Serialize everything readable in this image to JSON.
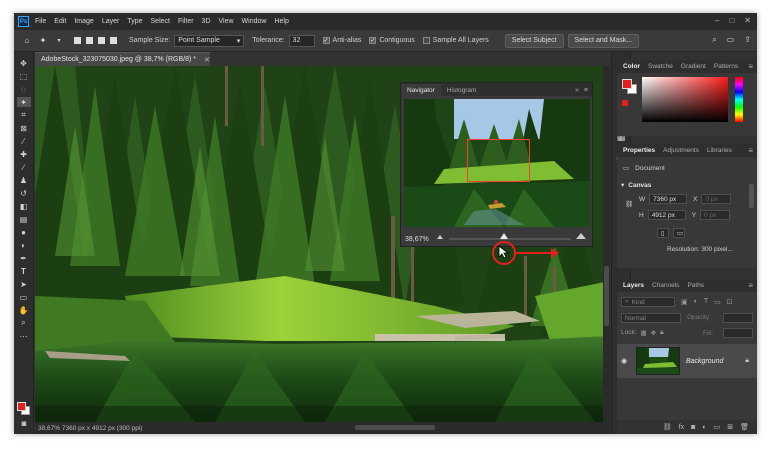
{
  "app": {
    "logo_text": "Ps",
    "menu": [
      "File",
      "Edit",
      "Image",
      "Layer",
      "Type",
      "Select",
      "Filter",
      "3D",
      "View",
      "Window",
      "Help"
    ],
    "window_controls": [
      "–",
      "□",
      "✕"
    ]
  },
  "options_bar": {
    "sample_size_label": "Sample Size:",
    "sample_size_value": "Point Sample",
    "tolerance_label": "Tolerance:",
    "tolerance_value": "32",
    "anti_alias_label": "Anti-alias",
    "anti_alias_checked": true,
    "contiguous_label": "Contiguous",
    "contiguous_checked": true,
    "sample_all_layers_label": "Sample All Layers",
    "sample_all_layers_checked": false,
    "select_subject_label": "Select Subject",
    "select_and_mask_label": "Select and Mask..."
  },
  "document": {
    "tab_title": "AdobeStock_323075030.jpeg @ 38,7% (RGB/8) *",
    "status_text": "38,67%   7360 px x 4912 px (300 ppi)"
  },
  "navigator": {
    "tabs": [
      "Navigator",
      "Histogram"
    ],
    "active_tab": "Navigator",
    "zoom": "38,67%",
    "zoom_slider_fraction": 0.45,
    "view_box_color": "#ff3b2f"
  },
  "annotation": {
    "color": "#e3201b"
  },
  "color_panel": {
    "tabs": [
      "Color",
      "Swatche",
      "Gradient",
      "Patterns"
    ],
    "active_tab": "Color",
    "foreground": "#e51e1e",
    "background": "#ffffff"
  },
  "properties_panel": {
    "tabs": [
      "Properties",
      "Adjustments",
      "Libraries"
    ],
    "active_tab": "Properties",
    "type_label": "Document",
    "section_title": "Canvas",
    "width_label": "W",
    "width_value": "7360 px",
    "height_label": "H",
    "height_value": "4912 px",
    "x_label": "X",
    "x_value": "0 px",
    "y_label": "Y",
    "y_value": "0 px",
    "resolution": "Resolution: 300 pixel..."
  },
  "layers_panel": {
    "tabs": [
      "Layers",
      "Channels",
      "Paths"
    ],
    "active_tab": "Layers",
    "filter_placeholder": "Kind",
    "blend_mode": "Normal",
    "opacity_label": "Opacity:",
    "lock_label": "Lock:",
    "fill_label": "Fill:",
    "layer_name": "Background"
  }
}
